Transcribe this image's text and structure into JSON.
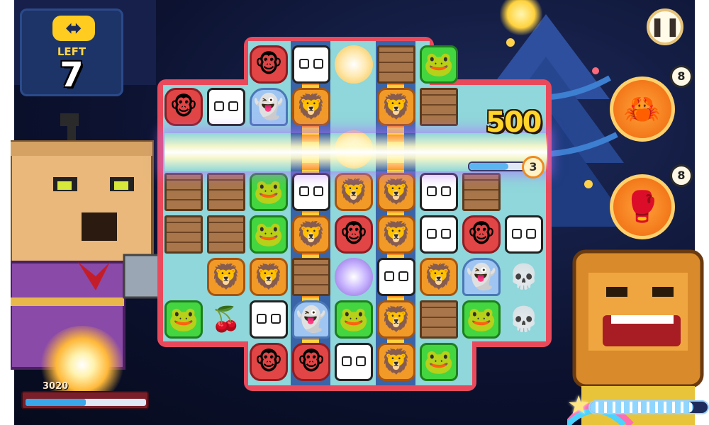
{
  "moves": {
    "icon": "swap-arrows-icon",
    "glyph": "⬌",
    "label": "LEFT",
    "count": "7"
  },
  "pause_button": {
    "icon": "pause-icon",
    "glyph": "❚❚"
  },
  "boosters": [
    {
      "name": "claw-booster",
      "icon": "claw-icon",
      "glyph": "🦀",
      "count": "8"
    },
    {
      "name": "punch-booster",
      "icon": "boxing-glove-icon",
      "glyph": "🥊",
      "count": "8"
    }
  ],
  "score_popup": "500",
  "capture_counter": "3",
  "player": {
    "score": "3020",
    "score_fill": 0.5
  },
  "star_meter": {
    "icon": "star-icon",
    "glyph": "★",
    "fill": 0.88
  },
  "board": {
    "tiles": [
      {
        "col": 2,
        "row": 0,
        "type": "monkey"
      },
      {
        "col": 3,
        "row": 0,
        "type": "panda"
      },
      {
        "col": 4,
        "row": 0,
        "type": "orb-target"
      },
      {
        "col": 5,
        "row": 0,
        "type": "crate"
      },
      {
        "col": 6,
        "row": 0,
        "type": "frog"
      },
      {
        "col": 0,
        "row": 1,
        "type": "monkey"
      },
      {
        "col": 1,
        "row": 1,
        "type": "panda"
      },
      {
        "col": 2,
        "row": 1,
        "type": "ghost"
      },
      {
        "col": 3,
        "row": 1,
        "type": "lion"
      },
      {
        "col": 5,
        "row": 1,
        "type": "lion"
      },
      {
        "col": 6,
        "row": 1,
        "type": "crate"
      },
      {
        "col": 4,
        "row": 2,
        "type": "orb"
      },
      {
        "col": 0,
        "row": 3,
        "type": "crate"
      },
      {
        "col": 1,
        "row": 3,
        "type": "crate"
      },
      {
        "col": 2,
        "row": 3,
        "type": "frog"
      },
      {
        "col": 3,
        "row": 3,
        "type": "panda"
      },
      {
        "col": 4,
        "row": 3,
        "type": "lion"
      },
      {
        "col": 5,
        "row": 3,
        "type": "lion"
      },
      {
        "col": 6,
        "row": 3,
        "type": "panda"
      },
      {
        "col": 7,
        "row": 3,
        "type": "crate"
      },
      {
        "col": 0,
        "row": 4,
        "type": "crate"
      },
      {
        "col": 1,
        "row": 4,
        "type": "crate"
      },
      {
        "col": 2,
        "row": 4,
        "type": "frog"
      },
      {
        "col": 3,
        "row": 4,
        "type": "lion"
      },
      {
        "col": 4,
        "row": 4,
        "type": "monkey"
      },
      {
        "col": 5,
        "row": 4,
        "type": "lion"
      },
      {
        "col": 6,
        "row": 4,
        "type": "panda"
      },
      {
        "col": 7,
        "row": 4,
        "type": "monkey"
      },
      {
        "col": 8,
        "row": 4,
        "type": "panda"
      },
      {
        "col": 1,
        "row": 5,
        "type": "lion"
      },
      {
        "col": 2,
        "row": 5,
        "type": "lion"
      },
      {
        "col": 3,
        "row": 5,
        "type": "crate"
      },
      {
        "col": 4,
        "row": 5,
        "type": "orb2"
      },
      {
        "col": 5,
        "row": 5,
        "type": "panda"
      },
      {
        "col": 6,
        "row": 5,
        "type": "lion"
      },
      {
        "col": 7,
        "row": 5,
        "type": "ghost"
      },
      {
        "col": 8,
        "row": 5,
        "type": "skull"
      },
      {
        "col": 0,
        "row": 6,
        "type": "frog"
      },
      {
        "col": 1,
        "row": 6,
        "type": "cherry"
      },
      {
        "col": 2,
        "row": 6,
        "type": "panda"
      },
      {
        "col": 3,
        "row": 6,
        "type": "ghost"
      },
      {
        "col": 4,
        "row": 6,
        "type": "frog"
      },
      {
        "col": 5,
        "row": 6,
        "type": "lion"
      },
      {
        "col": 6,
        "row": 6,
        "type": "crate"
      },
      {
        "col": 7,
        "row": 6,
        "type": "frog"
      },
      {
        "col": 8,
        "row": 6,
        "type": "skull"
      },
      {
        "col": 2,
        "row": 7,
        "type": "monkey"
      },
      {
        "col": 3,
        "row": 7,
        "type": "monkey"
      },
      {
        "col": 4,
        "row": 7,
        "type": "panda"
      },
      {
        "col": 5,
        "row": 7,
        "type": "lion"
      },
      {
        "col": 6,
        "row": 7,
        "type": "frog"
      }
    ]
  }
}
